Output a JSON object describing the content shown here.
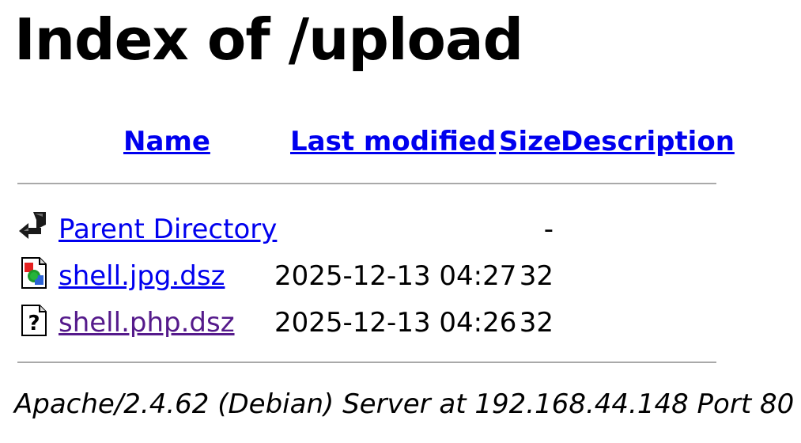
{
  "page": {
    "title": "Index of /upload"
  },
  "columns": {
    "name": "Name",
    "last_modified": "Last modified",
    "size": "Size",
    "description": "Description"
  },
  "rows": [
    {
      "icon": "back-arrow-icon",
      "name": "Parent Directory",
      "last_modified": "",
      "size": "-",
      "description": "",
      "visited": false
    },
    {
      "icon": "image-file-icon",
      "name": "shell.jpg.dsz",
      "last_modified": "2025-12-13 04:27",
      "size": "32",
      "description": "",
      "visited": false
    },
    {
      "icon": "unknown-file-icon",
      "name": "shell.php.dsz",
      "last_modified": "2025-12-13 04:26",
      "size": "32",
      "description": "",
      "visited": true
    }
  ],
  "footer": {
    "address": "Apache/2.4.62 (Debian) Server at 192.168.44.148 Port 80"
  },
  "colors": {
    "link": "#0000ee",
    "visited_link": "#551a8b",
    "rule": "#a9a9a9"
  }
}
